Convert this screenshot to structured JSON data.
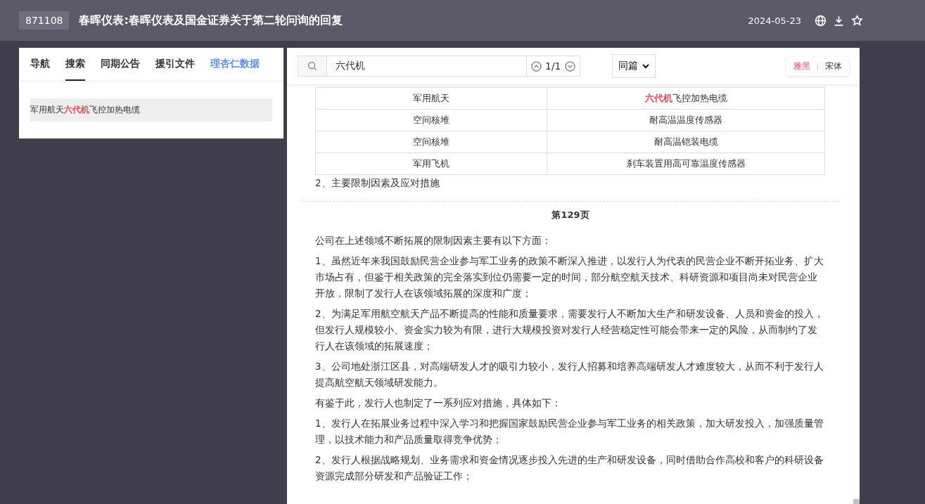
{
  "header": {
    "code": "871108",
    "title": "春晖仪表:春晖仪表及国金证券关于第二轮问询的回复",
    "date": "2024-05-23"
  },
  "sidebar": {
    "tabs": [
      {
        "label": "导航",
        "kind": "tab",
        "selected": false
      },
      {
        "label": "搜索",
        "kind": "tab",
        "selected": true
      },
      {
        "label": "同期公告",
        "kind": "tab",
        "selected": false
      },
      {
        "label": "援引文件",
        "kind": "tab",
        "selected": false
      },
      {
        "label": "理杏仁数据",
        "kind": "link",
        "selected": false
      }
    ],
    "results": [
      {
        "text": "军用航天**六代机**飞控加热电缆",
        "selected": true
      }
    ]
  },
  "search": {
    "value": "六代机",
    "counter": "1/1",
    "scope": "同篇"
  },
  "font_options": [
    {
      "label": "雅黑",
      "selected": true
    },
    {
      "label": "宋体",
      "selected": false
    }
  ],
  "document": {
    "table_rows": [
      {
        "cells": [
          "军用航天",
          "**六代机**飞控加热电缆"
        ]
      },
      {
        "cells": [
          "空间核堆",
          "耐高温温度传感器"
        ]
      },
      {
        "cells": [
          "空间核堆",
          "耐高温铠装电缆"
        ]
      },
      {
        "cells": [
          "军用飞机",
          "刹车装置用高可靠温度传感器"
        ]
      }
    ],
    "blocks": [
      {
        "kind": "paragraph",
        "text": "2、主要限制因素及应对措施"
      },
      {
        "kind": "page_break"
      },
      {
        "kind": "page_label",
        "text": "第129页"
      },
      {
        "kind": "paragraph",
        "text": "公司在上述领域不断拓展的限制因素主要有以下方面："
      },
      {
        "kind": "paragraph",
        "text": "1、虽然近年来我国鼓励民营企业参与军工业务的政策不断深入推进，以发行人为代表的民营企业不断开拓业务、扩大市场占有，但鉴于相关政策的完全落实到位仍需要一定的时间，部分航空航天技术、科研资源和项目尚未对民营企业开放，限制了发行人在该领域拓展的深度和广度；"
      },
      {
        "kind": "paragraph",
        "text": "2、为满足军用航空航天产品不断提高的性能和质量要求，需要发行人不断加大生产和研发设备、人员和资金的投入，但发行人规模较小、资金实力较为有限，进行大规模投资对发行人经营稳定性可能会带来一定的风险，从而制约了发行人在该领域的拓展速度；"
      },
      {
        "kind": "paragraph",
        "text": "3、公司地处浙江区县，对高端研发人才的吸引力较小，发行人招募和培养高端研发人才难度较大，从而不利于发行人提高航空航天领域研发能力。"
      },
      {
        "kind": "paragraph",
        "text": "有鉴于此，发行人也制定了一系列应对措施，具体如下："
      },
      {
        "kind": "paragraph",
        "text": "1、发行人在拓展业务过程中深入学习和把握国家鼓励民营企业参与军工业务的相关政策，加大研发投入，加强质量管理，以技术能力和产品质量取得竞争优势；"
      },
      {
        "kind": "paragraph",
        "text": "2、发行人根据战略规划、业务需求和资金情况逐步投入先进的生产和研发设备，同时借助合作高校和客户的科研设备资源完成部分研发和产品验证工作；"
      }
    ]
  }
}
